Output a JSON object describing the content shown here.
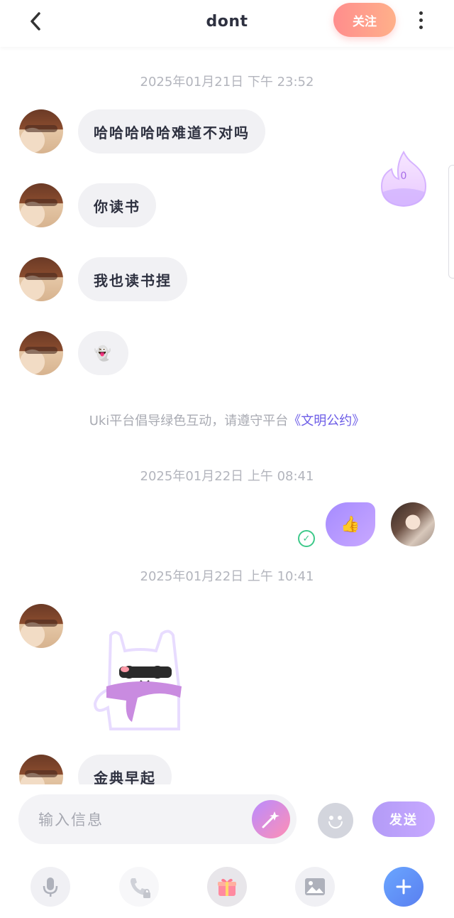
{
  "header": {
    "title": "dont",
    "follow_label": "关注"
  },
  "chat": {
    "timestamp_1": "2025年01月21日 下午 23:52",
    "timestamp_2": "2025年01月22日 上午 08:41",
    "timestamp_3": "2025年01月22日 上午 10:41",
    "messages": [
      {
        "sender": "other",
        "text": "哈哈哈哈哈难道不对吗"
      },
      {
        "sender": "other",
        "text": "你读书"
      },
      {
        "sender": "other",
        "text": "我也读书捏"
      },
      {
        "sender": "other",
        "text": "👻"
      },
      {
        "sender": "self",
        "text": "👍"
      },
      {
        "sender": "other",
        "text": "金典早起"
      }
    ],
    "notice_prefix": "Uki平台倡导绿色互动，请遵守平台",
    "notice_link": "《文明公约》",
    "fire_count": "0"
  },
  "input": {
    "placeholder": "输入信息",
    "send_label": "发送"
  },
  "toolbar": {
    "items": [
      "mic-icon",
      "phone-lock-icon",
      "gift-icon",
      "image-icon",
      "plus-icon"
    ]
  },
  "colors": {
    "accent": "#6c5ce7",
    "follow_gradient_start": "#ff8d8d",
    "send_gradient": "#b39bf7",
    "read_check": "#3ec98a"
  }
}
